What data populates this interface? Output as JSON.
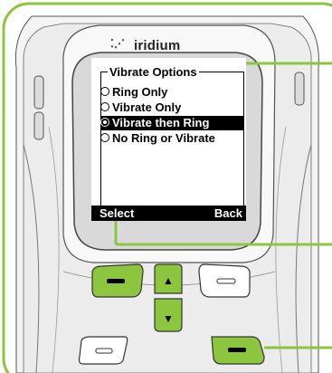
{
  "brand": {
    "dots": "⁚⋰",
    "name": "iridium"
  },
  "menu": {
    "title": "Vibrate Options",
    "options": [
      {
        "label": "Ring Only",
        "selected": false
      },
      {
        "label": "Vibrate Only",
        "selected": false
      },
      {
        "label": "Vibrate then Ring",
        "selected": true
      },
      {
        "label": "No Ring or Vibrate",
        "selected": false
      }
    ]
  },
  "softkeys": {
    "left": "Select",
    "right": "Back"
  },
  "keys": {
    "up_arrow": "▲",
    "down_arrow": "▼"
  },
  "colors": {
    "callout": "#8cc63f",
    "highlight_key": "#8cc63f",
    "screen_bg": "#ffffff",
    "bezel": "#e6e6e6"
  }
}
